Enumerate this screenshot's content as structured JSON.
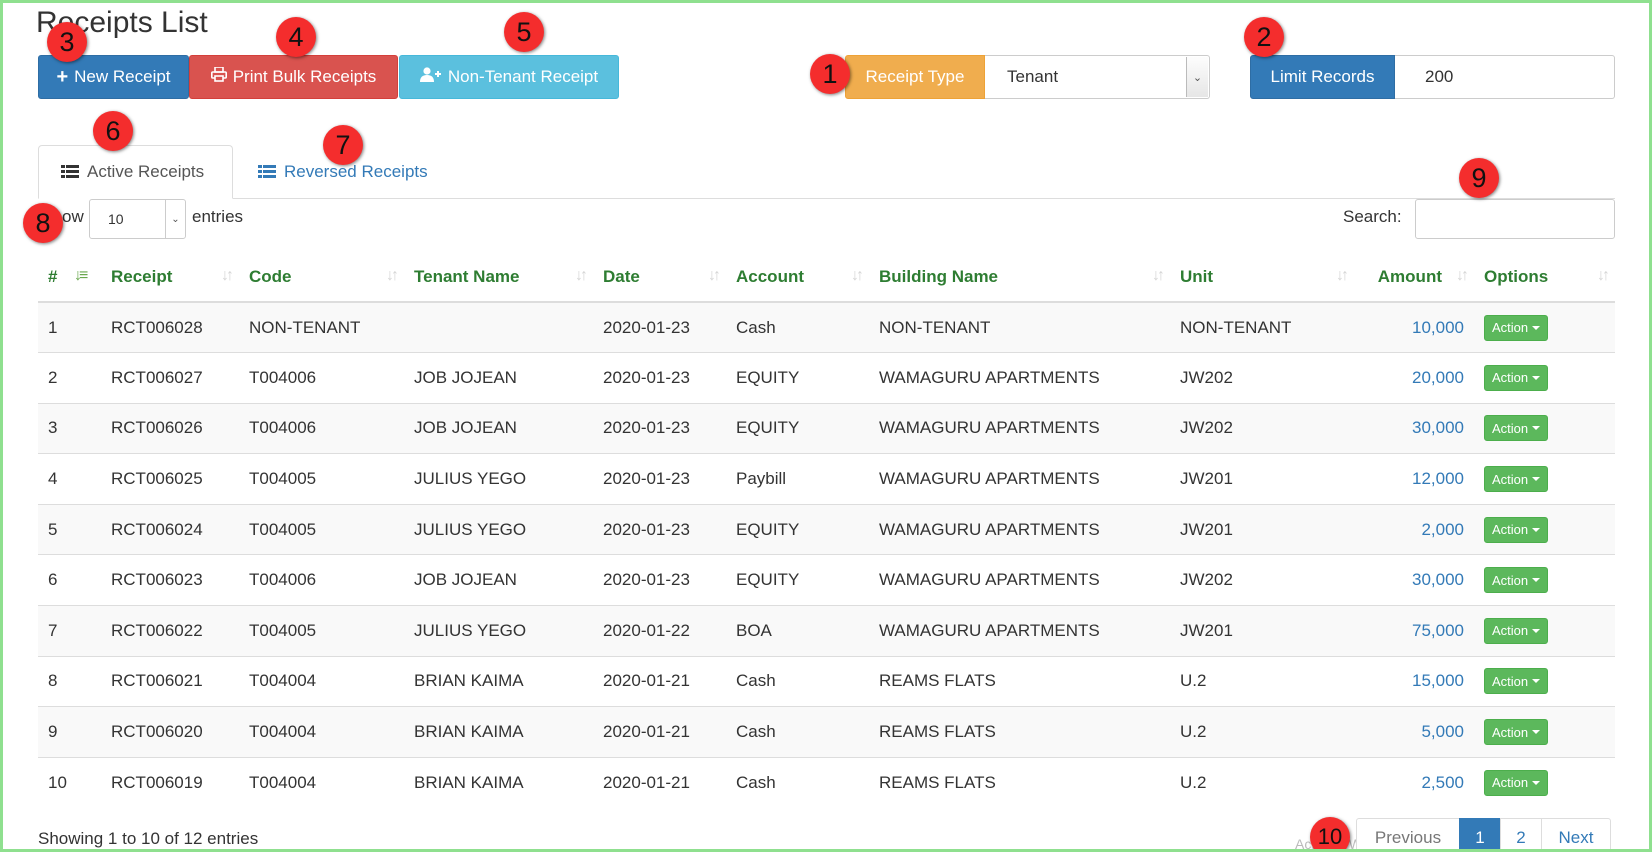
{
  "page": {
    "title": "Receipts List"
  },
  "toolbar": {
    "new_receipt": "New Receipt",
    "print_bulk": "Print Bulk Receipts",
    "non_tenant": "Non-Tenant Receipt"
  },
  "filters": {
    "receipt_type_label": "Receipt Type",
    "receipt_type_value": "Tenant",
    "limit_label": "Limit Records",
    "limit_value": "200"
  },
  "tabs": [
    {
      "label": "Active Receipts",
      "active": true
    },
    {
      "label": "Reversed Receipts",
      "active": false
    }
  ],
  "length_menu": {
    "prefix": "ow",
    "value": "10",
    "suffix": "entries"
  },
  "search": {
    "label": "Search:",
    "value": ""
  },
  "table": {
    "columns": [
      "#",
      "Receipt",
      "Code",
      "Tenant Name",
      "Date",
      "Account",
      "Building Name",
      "Unit",
      "Amount",
      "Options"
    ],
    "rows": [
      {
        "n": "1",
        "receipt": "RCT006028",
        "code": "NON-TENANT",
        "tenant": "",
        "date": "2020-01-23",
        "account": "Cash",
        "building": "NON-TENANT",
        "unit": "NON-TENANT",
        "amount": "10,000",
        "option": "Action"
      },
      {
        "n": "2",
        "receipt": "RCT006027",
        "code": "T004006",
        "tenant": "JOB JOJEAN",
        "date": "2020-01-23",
        "account": "EQUITY",
        "building": "WAMAGURU APARTMENTS",
        "unit": "JW202",
        "amount": "20,000",
        "option": "Action"
      },
      {
        "n": "3",
        "receipt": "RCT006026",
        "code": "T004006",
        "tenant": "JOB JOJEAN",
        "date": "2020-01-23",
        "account": "EQUITY",
        "building": "WAMAGURU APARTMENTS",
        "unit": "JW202",
        "amount": "30,000",
        "option": "Action"
      },
      {
        "n": "4",
        "receipt": "RCT006025",
        "code": "T004005",
        "tenant": "JULIUS YEGO",
        "date": "2020-01-23",
        "account": "Paybill",
        "building": "WAMAGURU APARTMENTS",
        "unit": "JW201",
        "amount": "12,000",
        "option": "Action"
      },
      {
        "n": "5",
        "receipt": "RCT006024",
        "code": "T004005",
        "tenant": "JULIUS YEGO",
        "date": "2020-01-23",
        "account": "EQUITY",
        "building": "WAMAGURU APARTMENTS",
        "unit": "JW201",
        "amount": "2,000",
        "option": "Action"
      },
      {
        "n": "6",
        "receipt": "RCT006023",
        "code": "T004006",
        "tenant": "JOB JOJEAN",
        "date": "2020-01-23",
        "account": "EQUITY",
        "building": "WAMAGURU APARTMENTS",
        "unit": "JW202",
        "amount": "30,000",
        "option": "Action"
      },
      {
        "n": "7",
        "receipt": "RCT006022",
        "code": "T004005",
        "tenant": "JULIUS YEGO",
        "date": "2020-01-22",
        "account": "BOA",
        "building": "WAMAGURU APARTMENTS",
        "unit": "JW201",
        "amount": "75,000",
        "option": "Action"
      },
      {
        "n": "8",
        "receipt": "RCT006021",
        "code": "T004004",
        "tenant": "BRIAN KAIMA",
        "date": "2020-01-21",
        "account": "Cash",
        "building": "REAMS FLATS",
        "unit": "U.2",
        "amount": "15,000",
        "option": "Action"
      },
      {
        "n": "9",
        "receipt": "RCT006020",
        "code": "T004004",
        "tenant": "BRIAN KAIMA",
        "date": "2020-01-21",
        "account": "Cash",
        "building": "REAMS FLATS",
        "unit": "U.2",
        "amount": "5,000",
        "option": "Action"
      },
      {
        "n": "10",
        "receipt": "RCT006019",
        "code": "T004004",
        "tenant": "BRIAN KAIMA",
        "date": "2020-01-21",
        "account": "Cash",
        "building": "REAMS FLATS",
        "unit": "U.2",
        "amount": "2,500",
        "option": "Action"
      }
    ]
  },
  "footer": {
    "info": "Showing 1 to 10 of 12 entries",
    "pagination": {
      "previous": "Previous",
      "current": "1",
      "page2": "2",
      "next": "Next"
    }
  },
  "markers": [
    "1",
    "2",
    "3",
    "4",
    "5",
    "6",
    "7",
    "8",
    "9",
    "10"
  ],
  "colors": {
    "primary": "#337ab7",
    "danger": "#d9534f",
    "info": "#5bc0de",
    "warning": "#f0ad4e",
    "success": "#5cb85c",
    "header_green": "#2e7d32",
    "marker_red": "#f42d2d"
  }
}
